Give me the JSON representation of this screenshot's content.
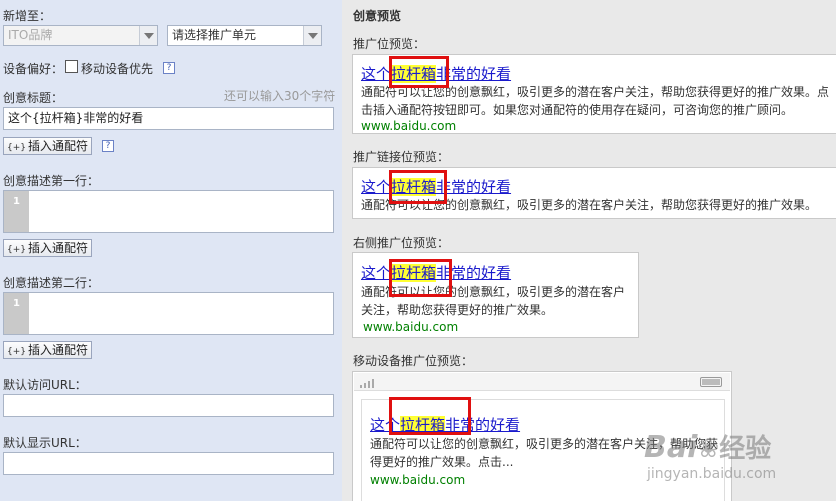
{
  "left": {
    "add_to_label": "新增至：",
    "plan_select": "ITO品牌",
    "unit_select": "请选择推广单元",
    "device_pref_label": "设备偏好：",
    "mobile_priority_label": "移动设备优先",
    "title_label": "创意标题：",
    "title_hint": "还可以输入30个字符",
    "title_value": "这个{拉杆箱}非常的好看",
    "insert_wildcard": "插入通配符",
    "insert_icon": "{+}",
    "desc1_label": "创意描述第一行：",
    "desc2_label": "创意描述第二行：",
    "line_number": "1",
    "visit_url_label": "默认访问URL：",
    "display_url_label": "默认显示URL：",
    "help_glyph": "?"
  },
  "right": {
    "heading": "创意预览",
    "sections": [
      {
        "label": "推广位预览：",
        "title_pre": "这个",
        "title_kw": "拉杆箱",
        "title_post": "非常的好看",
        "desc": "通配符可以让您的创意飘红，吸引更多的潜在客户关注，帮助您获得更好的推广效果。点击插入通配符按钮即可。如果您对通配符的使用存在疑问，可咨询您的推广顾问。",
        "url": "www.baidu.com"
      },
      {
        "label": "推广链接位预览：",
        "title_pre": "这个",
        "title_kw": "拉杆箱",
        "title_post": "非常的好看",
        "desc": "通配符可以让您的创意飘红，吸引更多的潜在客户关注，帮助您获得更好的推广效果。"
      },
      {
        "label": "右侧推广位预览：",
        "title_pre": "这个",
        "title_kw": "拉杆箱",
        "title_post": "非常的好看",
        "desc": "通配符可以让您的创意飘红，吸引更多的潜在客户关注，帮助您获得更好的推广效果。",
        "url": "www.baidu.com"
      },
      {
        "label": "移动设备推广位预览：",
        "title_pre": "这个",
        "title_kw": "拉杆箱",
        "title_post": "非常的好看",
        "desc": "通配符可以让您的创意飘红，吸引更多的潜在客户关注，帮助您获得更好的推广效果。点击...",
        "url": "www.baidu.com"
      }
    ],
    "watermark": {
      "brand_text": "Bai",
      "brand_cn": "经验",
      "url": "jingyan.baidu.com"
    }
  },
  "colors": {
    "left_panel_bg": "#dfe6f4",
    "link_blue": "#1a1acc",
    "keyword_highlight": "#ffff33",
    "url_green": "#008000",
    "annotation_red": "#e01010"
  }
}
